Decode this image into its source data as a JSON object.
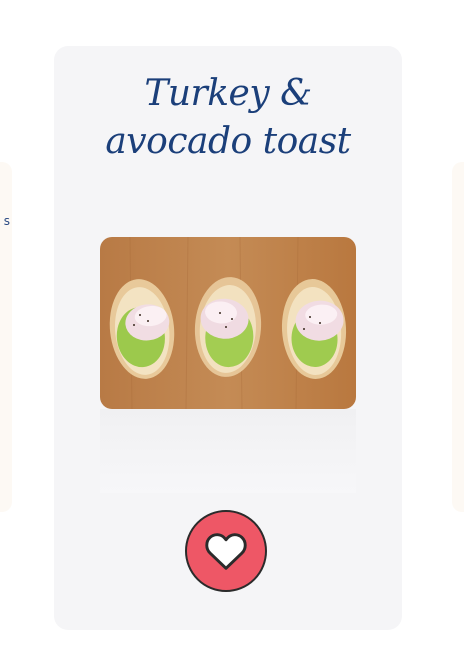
{
  "recipe": {
    "title_line1": "Turkey &",
    "title_line2": "avocado toast",
    "image_alt": "Turkey and avocado toast slices on a wooden board"
  },
  "side_left": {
    "peek_text": "s"
  },
  "like": {
    "icon": "heart-icon",
    "color": "#ee5766"
  }
}
